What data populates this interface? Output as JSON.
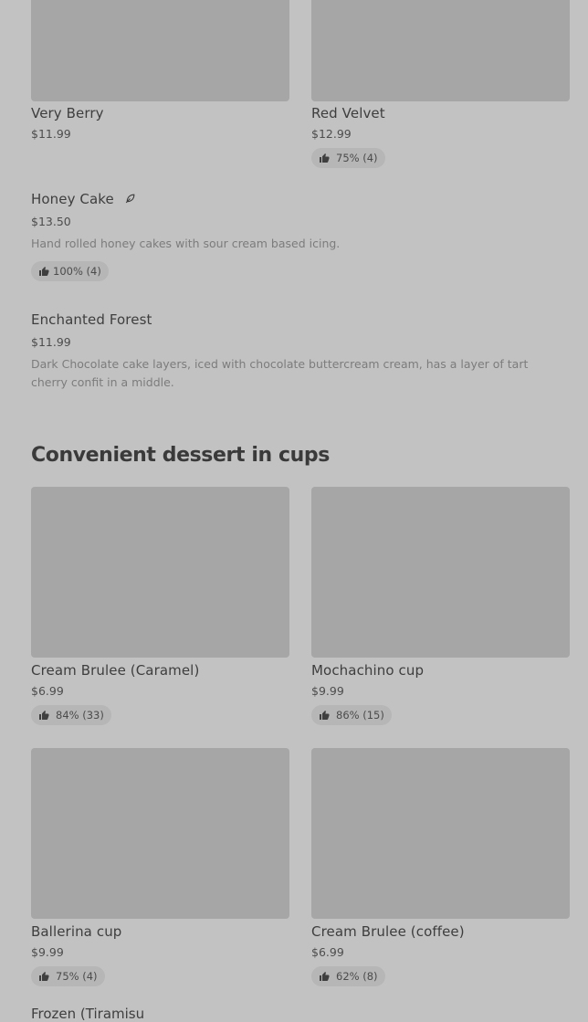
{
  "top_row": [
    {
      "name": "Very Berry",
      "price": "$11.99"
    },
    {
      "name": "Red Velvet",
      "price": "$12.99",
      "rating": "75% (4)"
    }
  ],
  "list_items": [
    {
      "name": "Honey Cake",
      "icon": "leaf-icon",
      "price": "$13.50",
      "description": "Hand rolled honey cakes with sour cream based icing.",
      "rating": "100% (4)"
    },
    {
      "name": "Enchanted Forest",
      "price": "$11.99",
      "description": "Dark Chocolate cake layers, iced with chocolate buttercream cream, has a layer of tart cherry confit in a middle."
    }
  ],
  "section": {
    "title": "Convenient dessert in cups",
    "cards": [
      {
        "name": "Cream Brulee (Caramel)",
        "price": "$6.99",
        "rating": "84% (33)"
      },
      {
        "name": "Mochachino cup",
        "price": "$9.99",
        "rating": "86% (15)"
      },
      {
        "name": "Ballerina cup",
        "price": "$9.99",
        "rating": "75% (4)"
      },
      {
        "name": "Cream Brulee (coffee)",
        "price": "$6.99",
        "rating": "62% (8)"
      }
    ],
    "next_item_partial": "Frozen (Tiramisu"
  },
  "colors": {
    "background": "#c2c2c2",
    "image_placeholder": "#a6a6a6",
    "pill": "#b6b6b6"
  }
}
